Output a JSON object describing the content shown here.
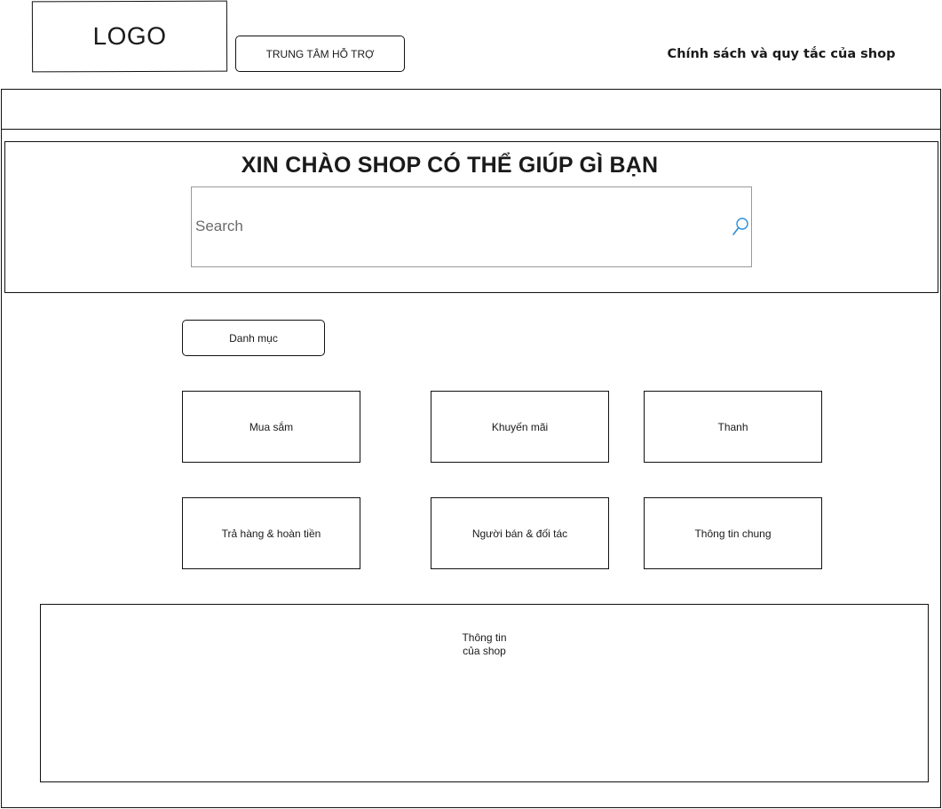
{
  "header": {
    "logo_text": "LOGO",
    "support_button_label": "TRUNG TÂM HỖ TRỢ",
    "policy_link_label": "Chính sách và quy tắc của shop"
  },
  "hero": {
    "title": "XIN CHÀO SHOP CÓ THỂ GIÚP GÌ BẠN",
    "search": {
      "placeholder": "Search",
      "value": ""
    }
  },
  "categories": {
    "button_label": "Danh mục",
    "tiles": [
      {
        "label": "Mua sắm"
      },
      {
        "label": "Khuyến mãi"
      },
      {
        "label": "Thanh"
      },
      {
        "label": "Trả hàng & hoàn tiền"
      },
      {
        "label": "Người bán  & đối tác"
      },
      {
        "label": "Thông tin chung"
      }
    ]
  },
  "shop_info": {
    "text": "Thông tin\ncủa shop"
  },
  "colors": {
    "border": "#111111",
    "search_border": "#999999",
    "search_icon": "#2a8fd6",
    "background": "#ffffff"
  },
  "icons": {
    "search": "search-icon"
  }
}
